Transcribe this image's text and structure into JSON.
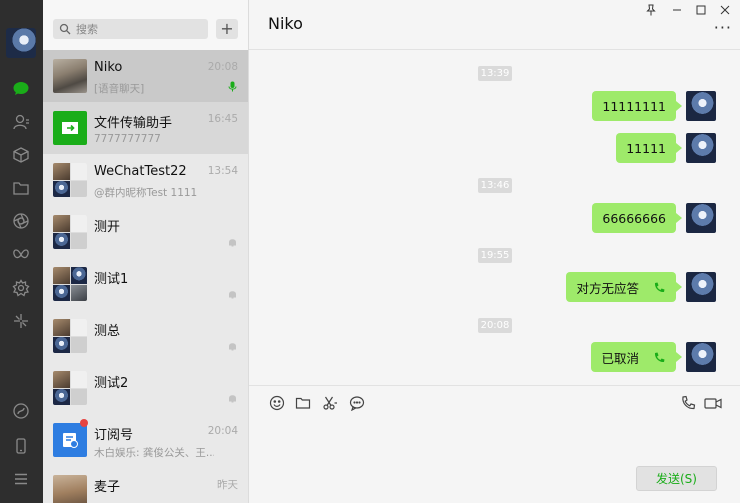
{
  "rail": {
    "items": [
      {
        "icon": "chat-icon",
        "active": true
      },
      {
        "icon": "contacts-icon"
      },
      {
        "icon": "favorites-cube-icon"
      },
      {
        "icon": "folder-icon"
      },
      {
        "icon": "moments-aperture-icon"
      },
      {
        "icon": "butterfly-icon"
      },
      {
        "icon": "plugin-gear-icon"
      },
      {
        "icon": "sparkle-icon"
      },
      {
        "icon": "mini-program-icon"
      },
      {
        "icon": "phone-icon"
      },
      {
        "icon": "menu-icon"
      }
    ]
  },
  "search": {
    "placeholder": "搜索",
    "add_label": "+"
  },
  "chats": [
    {
      "name": "Niko",
      "sub": "[语音聊天]",
      "time": "20:08",
      "avatar": "photo",
      "badge": "mic-icon",
      "active": true
    },
    {
      "name": "文件传输助手",
      "sub": "7777777777",
      "time": "16:45",
      "avatar": "file-transfer",
      "hover": true
    },
    {
      "name": "WeChatTest22",
      "sub": "@群内昵称Test 1111",
      "time": "13:54",
      "avatar": "group"
    },
    {
      "name": "测开",
      "sub": "",
      "time": "",
      "avatar": "group",
      "badge": "mute-bell-icon"
    },
    {
      "name": "测试1",
      "sub": "",
      "time": "",
      "avatar": "group4",
      "badge": "mute-bell-icon"
    },
    {
      "name": "测总",
      "sub": "",
      "time": "",
      "avatar": "group",
      "badge": "mute-bell-icon"
    },
    {
      "name": "测试2",
      "sub": "",
      "time": "",
      "avatar": "group",
      "badge": "mute-bell-icon"
    },
    {
      "name": "订阅号",
      "sub": "木白娱乐: 龚俊公关、王...",
      "time": "20:04",
      "avatar": "subscription",
      "unread_dot": true
    },
    {
      "name": "麦子",
      "sub": "",
      "time": "昨天",
      "avatar": "warm"
    }
  ],
  "conversation": {
    "title": "Niko",
    "window_buttons": [
      "pin-icon",
      "minimize-icon",
      "maximize-icon",
      "close-icon"
    ],
    "more_label": "···",
    "timestamps": [
      "13:39",
      "13:46",
      "19:55",
      "20:08"
    ],
    "messages": [
      {
        "text": "11111111",
        "call": false
      },
      {
        "text": "11111",
        "call": false
      },
      {
        "text": "66666666",
        "call": false
      },
      {
        "text": "对方无应答",
        "call": true
      },
      {
        "text": "已取消",
        "call": true
      }
    ],
    "toolbar": [
      "emoji-icon",
      "folder-icon",
      "scissors-icon",
      "chat-bubble-icon",
      "voice-call-icon",
      "video-call-icon"
    ],
    "input_value": "",
    "send_label": "发送(S)"
  },
  "colors": {
    "accent_green": "#1aad19",
    "bubble_green": "#9eea6a",
    "rail_bg": "#2e2e2e",
    "list_bg": "#e6e6e6",
    "active_item": "#c9c9c9"
  }
}
